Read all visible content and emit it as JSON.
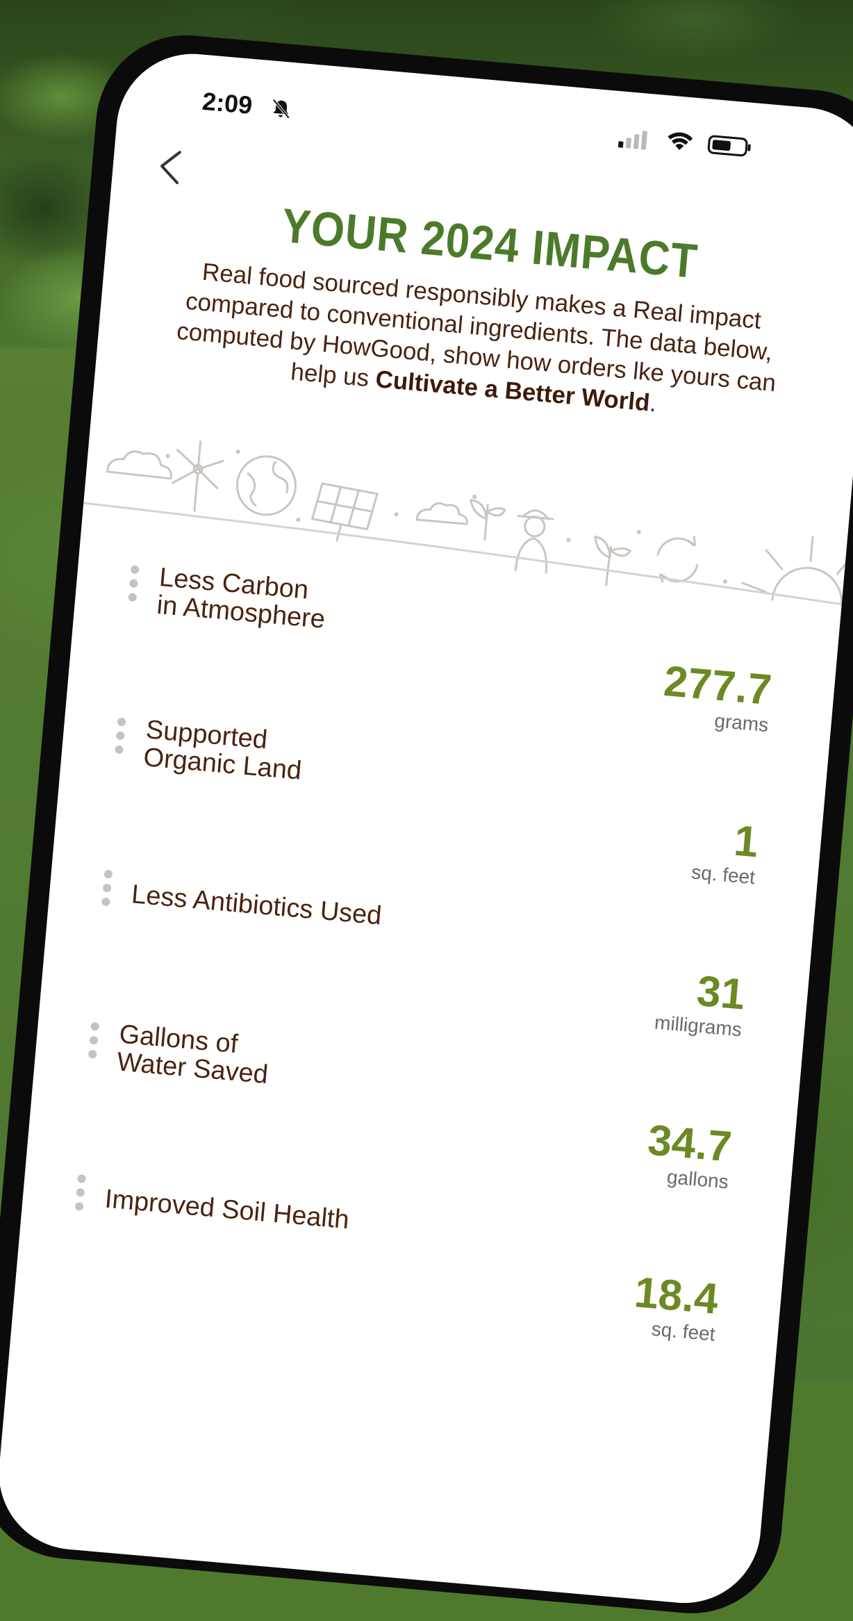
{
  "status_bar": {
    "time": "2:09",
    "icons": [
      "bell-slash-icon",
      "cellular-signal-icon",
      "wifi-icon",
      "battery-icon"
    ]
  },
  "nav": {
    "back_icon": "chevron-left-icon"
  },
  "page": {
    "title": "YOUR 2024 IMPACT",
    "intro_text": "Real food sourced responsibly makes a Real impact compared to conventional ingredients. The data below, computed by HowGood, show how orders lke yours can help us ",
    "intro_emphasis": "Cultivate a Better World",
    "intro_end": "."
  },
  "illustration_icons": [
    "cloud-icon",
    "windmill-icon",
    "globe-icon",
    "solar-panel-icon",
    "farmer-icon",
    "sprout-icon",
    "recycle-icon",
    "sun-icon"
  ],
  "metrics": [
    {
      "label": "Less Carbon\nin Atmosphere",
      "value": "277.7",
      "unit": "grams"
    },
    {
      "label": "Supported\nOrganic Land",
      "value": "1",
      "unit": "sq. feet"
    },
    {
      "label": "Less Antibiotics Used",
      "value": "31",
      "unit": "milligrams"
    },
    {
      "label": "Gallons of\nWater Saved",
      "value": "34.7",
      "unit": "gallons"
    },
    {
      "label": "Improved Soil Health",
      "value": "18.4",
      "unit": "sq. feet"
    }
  ],
  "colors": {
    "title_green": "#4c7a2b",
    "value_green": "#6b8a23",
    "text_brown": "#4a2310",
    "background_green": "#4f7a2e"
  }
}
